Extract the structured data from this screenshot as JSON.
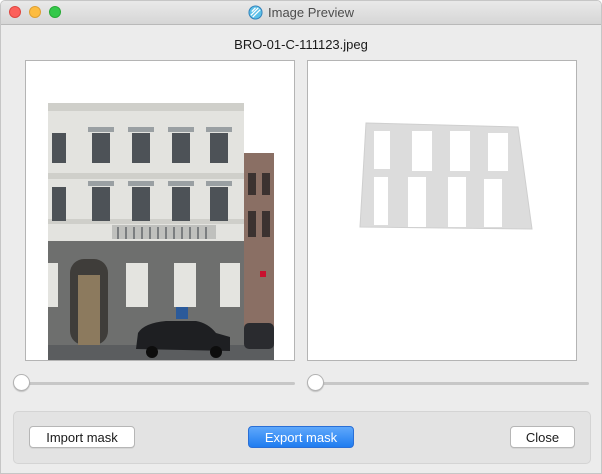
{
  "window": {
    "title": "Image Preview",
    "app_icon": "app-globe-icon"
  },
  "preview": {
    "filename": "BRO-01-C-111123.jpeg",
    "left_image": "building-facade-photo",
    "right_image": "facade-mask-preview"
  },
  "sliders": {
    "left_value": 0,
    "right_value": 0
  },
  "buttons": {
    "import_label": "Import mask",
    "export_label": "Export mask",
    "close_label": "Close"
  },
  "colors": {
    "accent": "#1f7cf0",
    "close_light": "#fc605b",
    "minimize_light": "#fdbc40",
    "zoom_light": "#34c84a"
  }
}
